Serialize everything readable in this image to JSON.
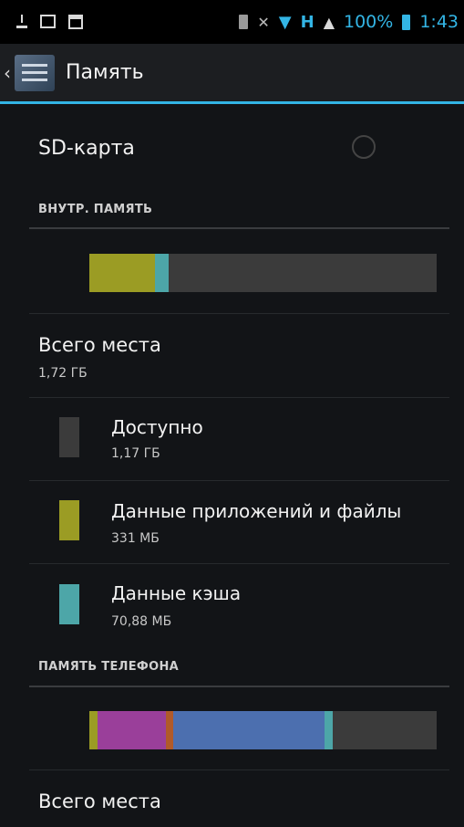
{
  "status_bar": {
    "left_icons": [
      "download-icon",
      "image-icon",
      "calendar-icon"
    ],
    "right_icons": [
      "sd-card-icon",
      "mute-icon",
      "wifi-icon",
      "network-icon",
      "signal-icon",
      "battery-icon"
    ],
    "network_text": "H",
    "battery": "100%",
    "time": "1:43"
  },
  "action_bar": {
    "title": "Память"
  },
  "sd_card": {
    "label": "SD-карта"
  },
  "internal": {
    "header": "ВНУТР. ПАМЯТЬ",
    "total_label": "Всего места",
    "total_value": "1,72 ГБ",
    "items": [
      {
        "label": "Доступно",
        "value": "1,17 ГБ",
        "color": "#3b3b3b"
      },
      {
        "label": "Данные приложений и файлы",
        "value": "331 МБ",
        "color": "#9b9c24"
      },
      {
        "label": "Данные кэша",
        "value": "70,88 МБ",
        "color": "#4da6a8"
      }
    ],
    "bar": [
      {
        "name": "apps",
        "color": "#9b9c24",
        "fraction": 0.188
      },
      {
        "name": "cache",
        "color": "#4da6a8",
        "fraction": 0.04
      },
      {
        "name": "available",
        "color": "#3b3b3b",
        "fraction": 0.772
      }
    ]
  },
  "phone": {
    "header": "ПАМЯТЬ ТЕЛЕФОНА",
    "total_label": "Всего места",
    "bar": [
      {
        "name": "seg-olive",
        "color": "#9b9c24",
        "fraction": 0.024
      },
      {
        "name": "seg-purple",
        "color": "#9a3f9a",
        "fraction": 0.197
      },
      {
        "name": "seg-orange",
        "color": "#b05a2a",
        "fraction": 0.021
      },
      {
        "name": "seg-blue",
        "color": "#4c6faf",
        "fraction": 0.436
      },
      {
        "name": "seg-teal",
        "color": "#4da6a8",
        "fraction": 0.022
      },
      {
        "name": "seg-free",
        "color": "#3b3b3b",
        "fraction": 0.3
      }
    ]
  }
}
